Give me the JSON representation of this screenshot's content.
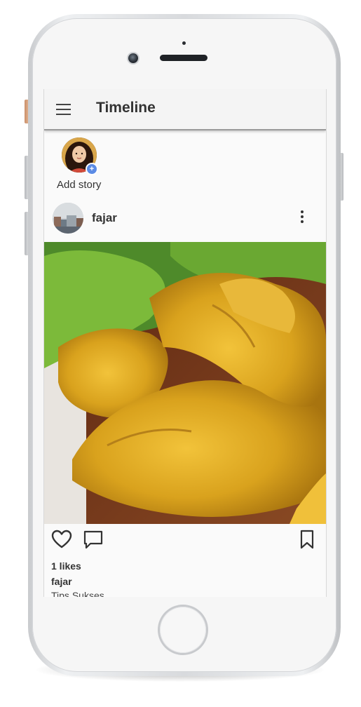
{
  "app_bar": {
    "title": "Timeline"
  },
  "stories": {
    "add_label": "Add story"
  },
  "post": {
    "username": "fajar",
    "likes": "1 likes",
    "caption_username": "fajar",
    "caption_text": "Tips Sukses"
  },
  "icons": [
    "menu-icon",
    "plus-icon",
    "more-vertical-icon",
    "heart-icon",
    "comment-icon",
    "bookmark-icon"
  ],
  "colors": {
    "badge": "#5b8be5",
    "screen_bg": "#fafafa",
    "text": "#333333"
  }
}
